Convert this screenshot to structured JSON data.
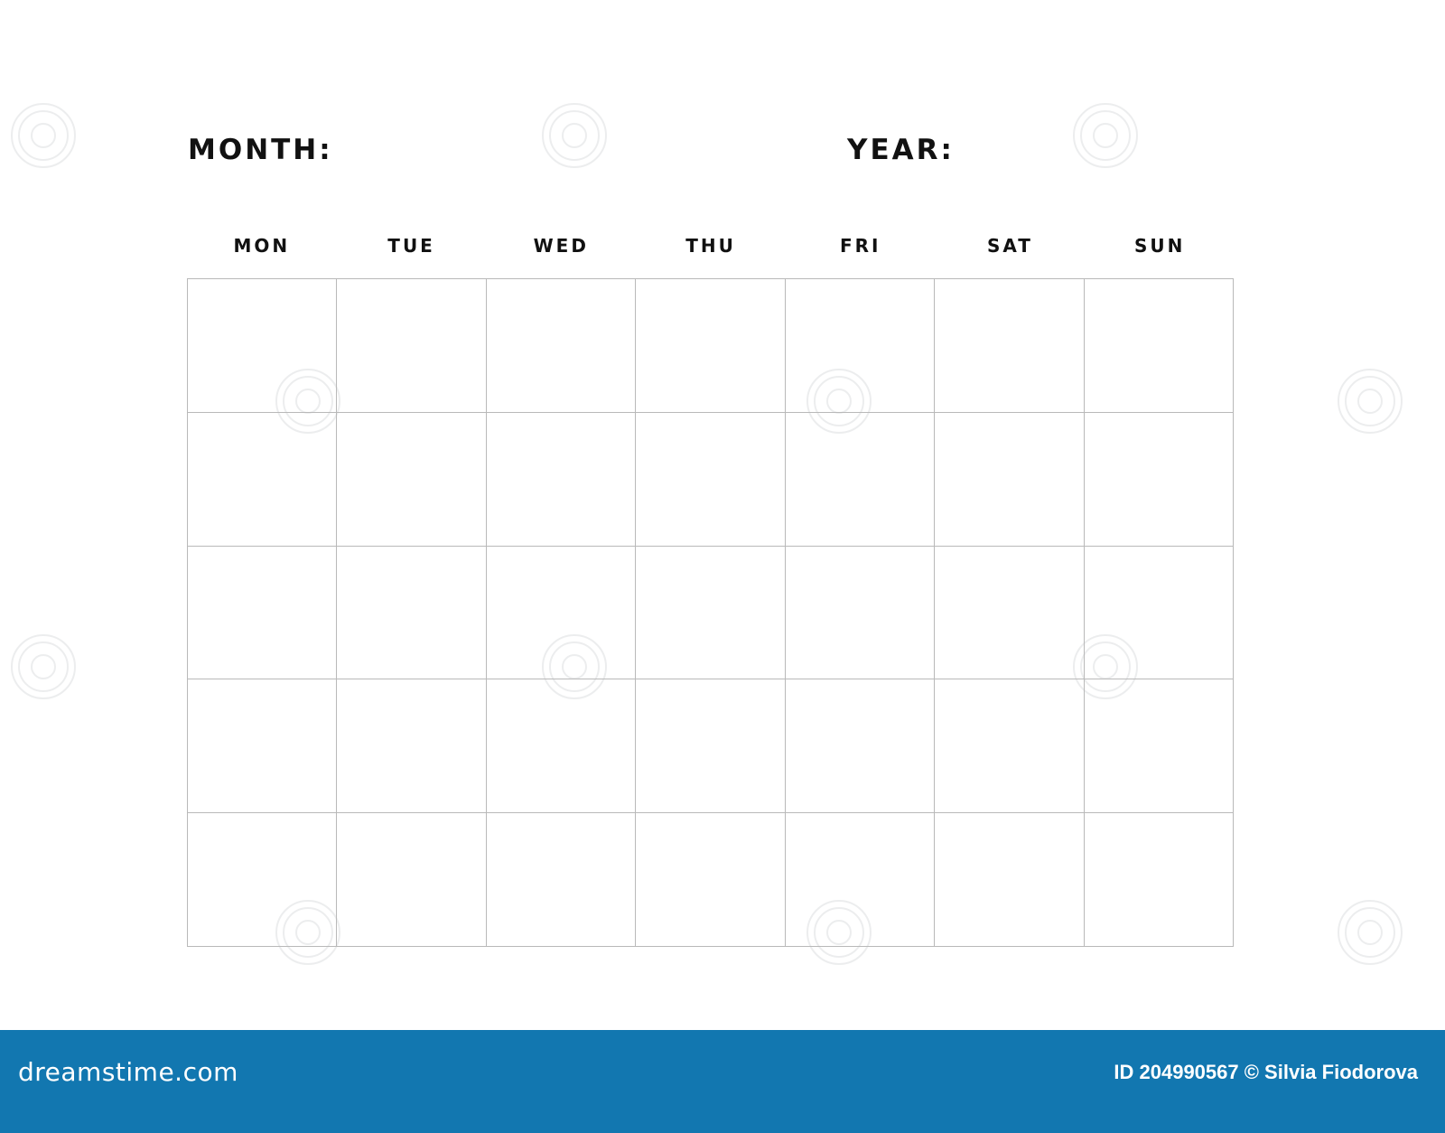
{
  "header": {
    "month_label": "MONTH:",
    "year_label": "YEAR:"
  },
  "calendar": {
    "weekdays": [
      "MON",
      "TUE",
      "WED",
      "THU",
      "FRI",
      "SAT",
      "SUN"
    ],
    "rows": 5,
    "columns": 7
  },
  "footer": {
    "logo_text": "dreamstime.com",
    "credit_text": "ID 204990567 © Silvia Fiodorova",
    "background_color": "#1277b0"
  }
}
